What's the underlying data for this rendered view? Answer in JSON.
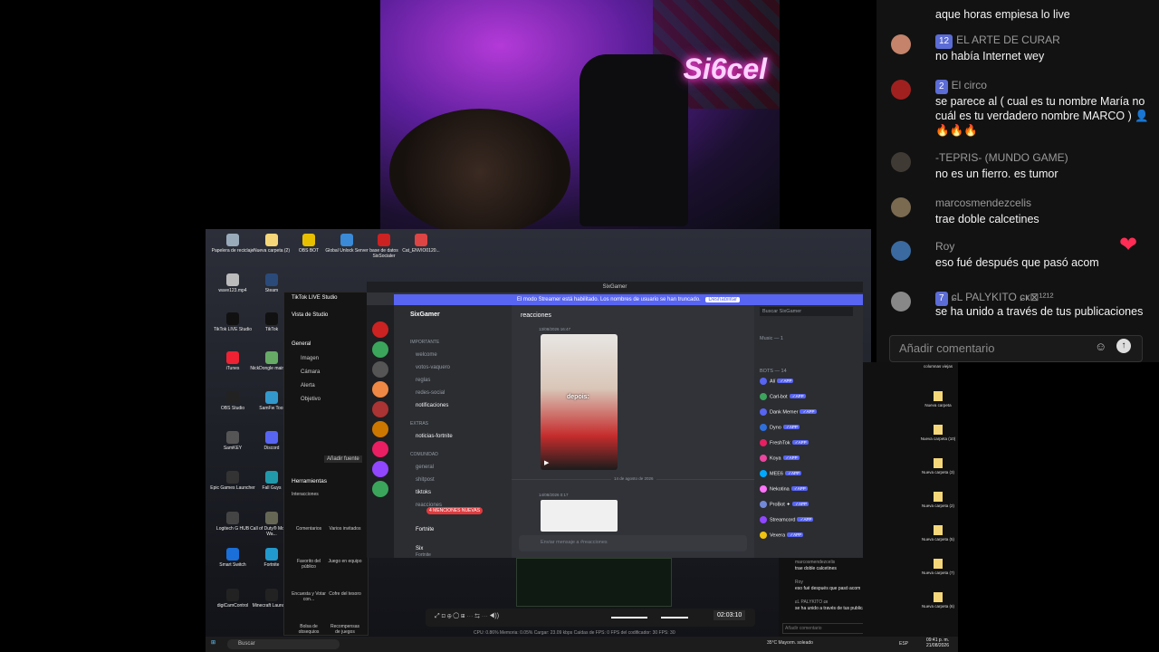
{
  "chat": {
    "messages": [
      {
        "user": "",
        "badge": "",
        "text": "aque horas empiesa lo live"
      },
      {
        "user": "EL ARTE DE CURAR",
        "badge": "12",
        "text": "no había Internet wey"
      },
      {
        "user": "El circo",
        "badge": "2",
        "text": "se parece al ( cual es tu nombre María no cuál es tu verdadero nombre MARCO ) 👤🔥🔥🔥"
      },
      {
        "user": "-TEPRIS- (MUNDO GAME)",
        "badge": "",
        "text": "no es un fierro. es tumor"
      },
      {
        "user": "marcosmendezcelis",
        "badge": "",
        "text": "trae doble calcetines"
      },
      {
        "user": "Roy",
        "badge": "",
        "text": "eso fué después que pasó acom"
      },
      {
        "user": "ɕL PALYKITO ɕҝ⊠¹²¹²",
        "badge": "7",
        "text": "se ha unido a través de tus publicaciones"
      }
    ],
    "input_placeholder": "Añadir comentario",
    "accent": "#ff2d55"
  },
  "webcam": {
    "neon_sign": "Si6cel"
  },
  "desktop_icons": [
    {
      "label": "Papelera de reciclaje"
    },
    {
      "label": "Nueva carpeta (2)"
    },
    {
      "label": "OBS BOT"
    },
    {
      "label": "Global Unlock Server"
    },
    {
      "label": "base de datos SixSocialer"
    },
    {
      "label": "Cat_ENVIO0120..."
    },
    {
      "label": "wave123.mp4"
    },
    {
      "label": "Steam"
    },
    {
      "label": "TikTok LIVE Studio"
    },
    {
      "label": "TikTok"
    },
    {
      "label": "iTunes"
    },
    {
      "label": "NickDongle main exe"
    },
    {
      "label": "OBS Studio"
    },
    {
      "label": "SamFw Tool"
    },
    {
      "label": "SamKEY"
    },
    {
      "label": "Discord"
    },
    {
      "label": "Epic Games Launcher"
    },
    {
      "label": "Fall Guys"
    },
    {
      "label": "Logitech G HUB"
    },
    {
      "label": "Call of Duty® Modern Wa..."
    },
    {
      "label": "Smart Switch"
    },
    {
      "label": "Fortnite"
    },
    {
      "label": "digiCamControl"
    },
    {
      "label": "Minecraft Launcher"
    }
  ],
  "tiktok_studio": {
    "title": "TikTok LIVE Studio",
    "view": "Vista de Studio",
    "section": "General",
    "sources": [
      "Imagen",
      "Cámara",
      "Alerta",
      "Objetivo"
    ],
    "add_source": "Añadir fuente",
    "tools_title": "Herramientas",
    "interactions": "Interacciones",
    "tools": [
      "Comentarios",
      "Varios invitados",
      "Favorito del público",
      "Juego en equipo",
      "Encuesta y Votar con...",
      "Cofre del tesoro",
      "Bolsa de obsequios",
      "Recompensas de juegos"
    ]
  },
  "discord": {
    "window_title": "SixGamer",
    "banner": "El modo Streamer está habilitado. Los nombres de usuario se han truncado.",
    "banner_button": "Deshabilitar",
    "server": "SixGamer",
    "channels": [
      {
        "name": "IMPORTANTE",
        "type": "category"
      },
      {
        "name": "welcome",
        "type": "text"
      },
      {
        "name": "votos-vaquero",
        "type": "text"
      },
      {
        "name": "reglas",
        "type": "text"
      },
      {
        "name": "redes-social",
        "type": "text"
      },
      {
        "name": "notificaciones",
        "type": "text"
      },
      {
        "name": "EXTRAS",
        "type": "category"
      },
      {
        "name": "noticias-fortnite",
        "type": "text"
      },
      {
        "name": "COMUNIDAD",
        "type": "category"
      },
      {
        "name": "general",
        "type": "text"
      },
      {
        "name": "shitpost",
        "type": "text"
      },
      {
        "name": "tiktoks",
        "type": "text"
      },
      {
        "name": "reacciones",
        "type": "text"
      }
    ],
    "new_mentions": "4 MENCIONES NUEVAS",
    "voice_channel": "Fortnite",
    "user": {
      "name": "Six",
      "status": "Fortnite"
    },
    "active_channel": "reacciones",
    "search_placeholder": "Buscar SixGamer",
    "post_caption": "depois:",
    "date_divider": "14 de agosto de 2026",
    "timestamp_1": "13/08/2026 16:47",
    "timestamp_2": "14/08/2026 0:17",
    "message_placeholder": "Enviar mensaje a #reacciones",
    "members_header_1": "Music — 1",
    "members_header_2": "BOTS — 14",
    "members": [
      {
        "name": "Alí",
        "color": "#5865f2"
      },
      {
        "name": "Carl-bot",
        "color": "#3ba55c"
      },
      {
        "name": "Dank Memer",
        "color": "#5865f2"
      },
      {
        "name": "Dyno",
        "color": "#2f6fdb"
      },
      {
        "name": "FreshTok",
        "color": "#e91e63"
      },
      {
        "name": "Koya",
        "color": "#eb459e"
      },
      {
        "name": "MEE6",
        "color": "#00aaff"
      },
      {
        "name": "Nekotina",
        "color": "#ff73fa"
      },
      {
        "name": "ProBot ✦",
        "color": "#7289da"
      },
      {
        "name": "Streamcord",
        "color": "#9146ff"
      },
      {
        "name": "Vexera",
        "color": "#f1c40f"
      }
    ]
  },
  "editor_toolbar": {
    "time": "02:03:10"
  },
  "stats": "CPU: 0.86%   Memoria: 0.05%   Cargar: 23.09 kbps   Caídas de FPS: 0   FPS del codificador: 30   FPS: 30",
  "mini_chat": [
    {
      "user": "marcosmendezcelis",
      "text": "trae doble calcetines"
    },
    {
      "user": "Roy",
      "text": "eso fué después que pasó acom"
    },
    {
      "user": "ɕL PALYKITO ɕҝ",
      "text": "se ha unido a través de tus publicaciones"
    }
  ],
  "mini_chat_placeholder": "Añadir comentario",
  "right_desk_icons": [
    "Nueva carpeta",
    "Nueva carpeta (10)",
    "Nueva carpeta (3)",
    "Nueva carpeta (2)",
    "Nueva carpeta (5)",
    "Nueva carpeta (7)",
    "Nueva carpeta (6)"
  ],
  "right_desk_labels": [
    "Nueva carpeta",
    "columnas viejas"
  ],
  "taskbar": {
    "search": "Buscar",
    "weather": "35°C  Mayorm. soleado",
    "lang": "ESP",
    "time": "09:41 p. m.",
    "date": "21/08/2026"
  }
}
